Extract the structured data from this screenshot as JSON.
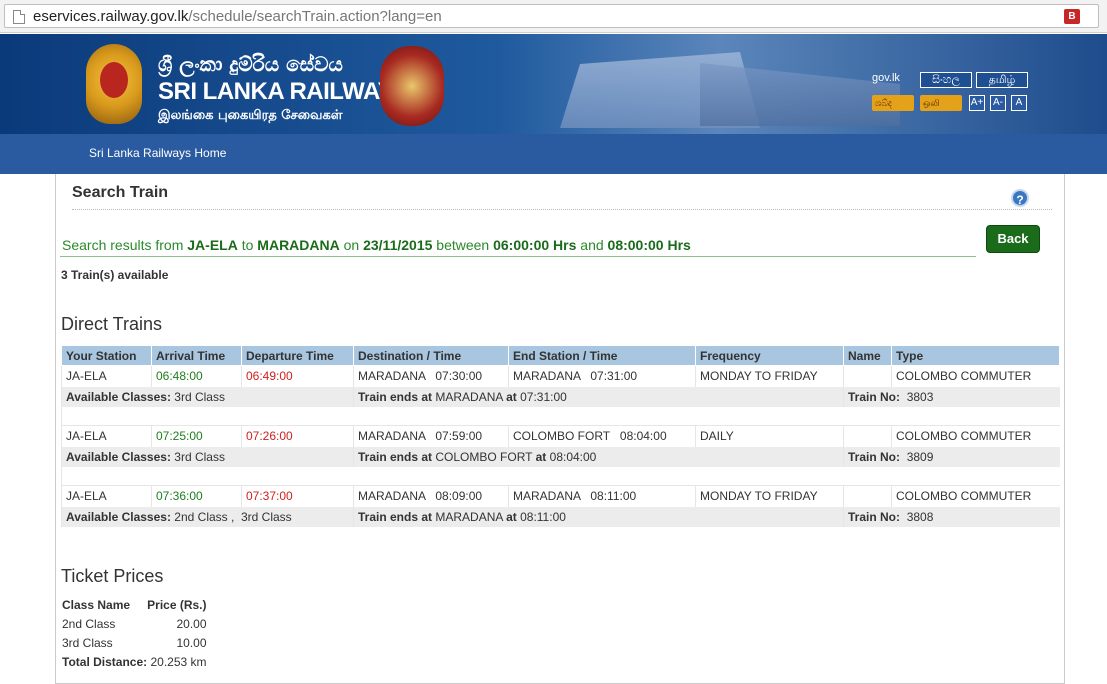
{
  "browser": {
    "url_domain": "eservices.railway.gov.lk",
    "url_path": "/schedule/searchTrain.action?lang=en",
    "ext_icon": "B"
  },
  "banner": {
    "name_si": "ශ්‍රී ලංකා දුම්රිය සේවය",
    "name_en": "SRI LANKA RAILWAYS",
    "name_ta": "இலங்கை புகையிரத சேவைகள்",
    "govlk": "gov.lk",
    "lang_si": "සිංහල",
    "lang_ta": "தமிழ்",
    "tag1": "ශබ්ද",
    "tag2": "ஒலி",
    "font_plus": "A+",
    "font_minus": "A-",
    "font_reset": "A"
  },
  "nav": {
    "home": "Sri Lanka Railways Home"
  },
  "page": {
    "title": "Search Train",
    "help_icon": "?",
    "result_prefix": "Search results from",
    "from": "JA-ELA",
    "to_word": "to",
    "to": "MARADANA",
    "on_word": "on",
    "date": "23/11/2015",
    "between_word": "between",
    "start": "06:00:00 Hrs",
    "and_word": "and",
    "end": "08:00:00 Hrs",
    "back": "Back",
    "count": "3 Train(s) available",
    "direct_heading": "Direct Trains",
    "ticket_heading": "Ticket Prices"
  },
  "columns": [
    "Your Station",
    "Arrival Time",
    "Departure Time",
    "Destination / Time",
    "End Station / Time",
    "Frequency",
    "Name",
    "Type"
  ],
  "labels": {
    "classes": "Available Classes:",
    "ends": "Train ends at",
    "at": "at",
    "trainno": "Train No:"
  },
  "trains": [
    {
      "station": "JA-ELA",
      "arrival": "06:48:00",
      "departure": "06:49:00",
      "destination": "MARADANA   07:30:00",
      "end": "MARADANA   07:31:00",
      "frequency": "MONDAY TO FRIDAY",
      "name": "",
      "type": "COLOMBO COMMUTER",
      "classes": "3rd Class",
      "end_station": "MARADANA",
      "end_time": "07:31:00",
      "number": "3803"
    },
    {
      "station": "JA-ELA",
      "arrival": "07:25:00",
      "departure": "07:26:00",
      "destination": "MARADANA   07:59:00",
      "end": "COLOMBO FORT   08:04:00",
      "frequency": "DAILY",
      "name": "",
      "type": "COLOMBO COMMUTER",
      "classes": "3rd Class",
      "end_station": "COLOMBO FORT",
      "end_time": "08:04:00",
      "number": "3809"
    },
    {
      "station": "JA-ELA",
      "arrival": "07:36:00",
      "departure": "07:37:00",
      "destination": "MARADANA   08:09:00",
      "end": "MARADANA   08:11:00",
      "frequency": "MONDAY TO FRIDAY",
      "name": "",
      "type": "COLOMBO COMMUTER",
      "classes": "2nd Class ,  3rd Class",
      "end_station": "MARADANA",
      "end_time": "08:11:00",
      "number": "3808"
    }
  ],
  "prices": {
    "col_class": "Class Name",
    "col_price": "Price (Rs.)",
    "rows": [
      {
        "class": "2nd Class",
        "price": "20.00"
      },
      {
        "class": "3rd Class",
        "price": "10.00"
      }
    ],
    "distance_label": "Total Distance:",
    "distance": "20.253 km"
  }
}
